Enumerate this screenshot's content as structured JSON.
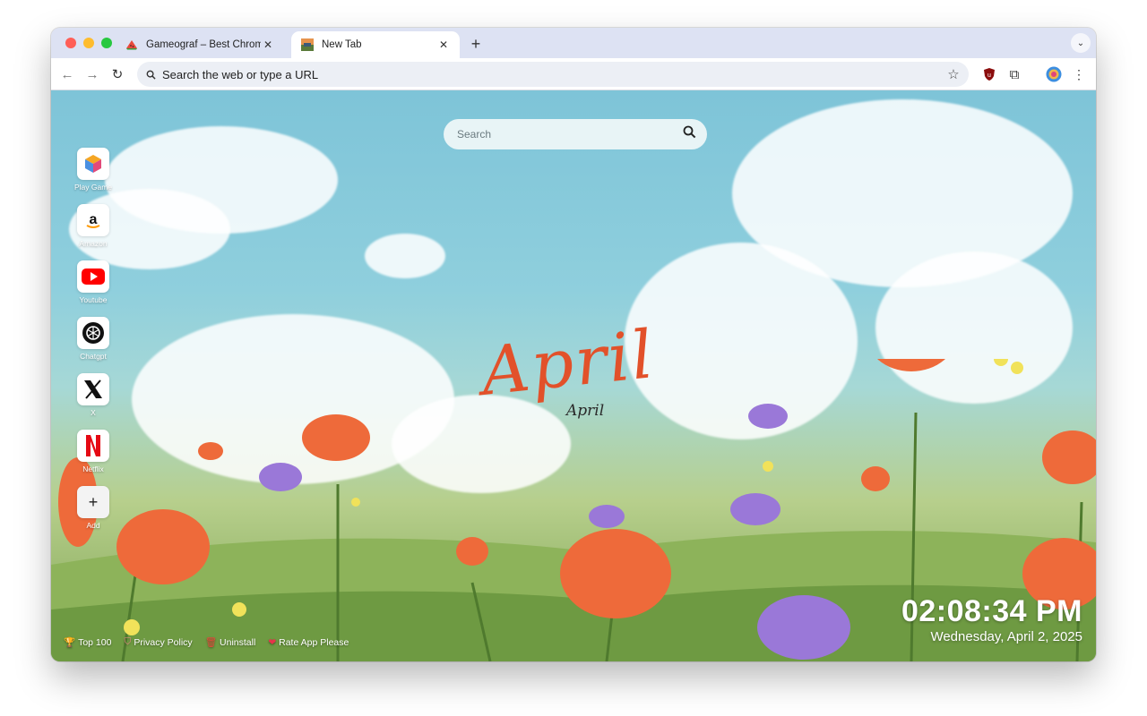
{
  "browser": {
    "tabs": [
      {
        "title": "Gameograf – Best Chrome Lit",
        "favicon": "watermelon-icon",
        "active": false
      },
      {
        "title": "New Tab",
        "favicon": "landscape-icon",
        "active": true
      }
    ],
    "new_tab_symbol": "+",
    "address_placeholder": "Search the web or type a URL",
    "colors": {
      "tabbar": "#dde2f3",
      "toolbar": "#ffffff",
      "omnibox": "#eceff5"
    }
  },
  "page": {
    "search_placeholder": "Search",
    "shortcuts": [
      {
        "label": "Play Game",
        "icon": "cube-icon"
      },
      {
        "label": "Amazon",
        "icon": "amazon-icon"
      },
      {
        "label": "Youtube",
        "icon": "youtube-icon"
      },
      {
        "label": "Chatgpt",
        "icon": "chatgpt-icon"
      },
      {
        "label": "X",
        "icon": "x-icon"
      },
      {
        "label": "Netflix",
        "icon": "netflix-icon"
      },
      {
        "label": "Add",
        "icon": "plus-icon"
      }
    ],
    "wallpaper_title": "April",
    "wallpaper_subtitle": "April",
    "footer_links": [
      {
        "label": "Top 100",
        "icon": "trophy-icon"
      },
      {
        "label": "Privacy Policy",
        "icon": "shield-icon"
      },
      {
        "label": "Uninstall",
        "icon": "trash-icon"
      },
      {
        "label": "Rate App Please",
        "icon": "heart-icon"
      }
    ],
    "clock": {
      "time": "02:08:34 PM",
      "date": "Wednesday, April 2, 2025"
    },
    "colors": {
      "title_accent": "#e2512a",
      "sky": "#8fcfdd",
      "grass": "#7da352"
    }
  }
}
